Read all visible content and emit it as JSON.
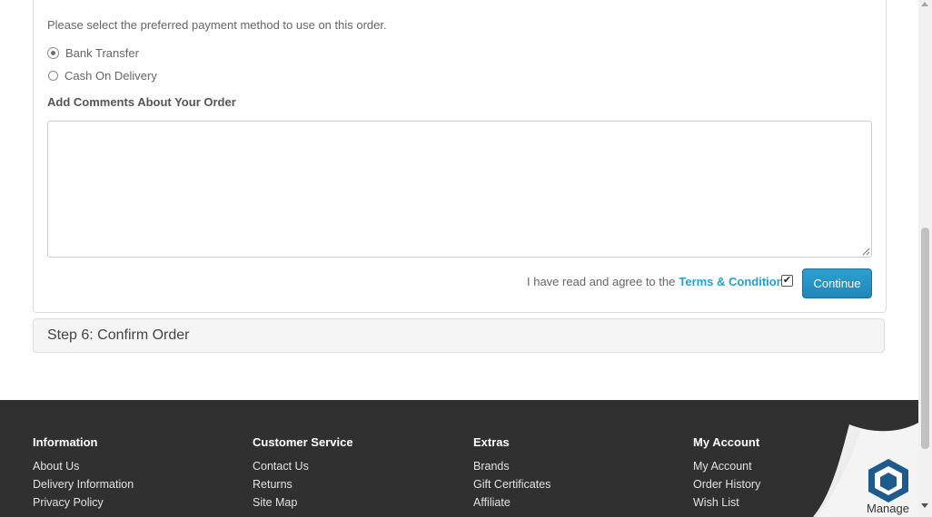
{
  "payment": {
    "instruction": "Please select the preferred payment method to use on this order.",
    "options": [
      {
        "label": "Bank Transfer",
        "selected": true
      },
      {
        "label": "Cash On Delivery",
        "selected": false
      }
    ],
    "comments_label": "Add Comments About Your Order",
    "comments_value": "",
    "agree_text": "I have read and agree to the",
    "terms_link": "Terms & Conditions",
    "agree_checked": true,
    "continue_label": "Continue"
  },
  "step6": {
    "title": "Step 6: Confirm Order"
  },
  "footer": {
    "columns": [
      {
        "heading": "Information",
        "links": [
          "About Us",
          "Delivery Information",
          "Privacy Policy"
        ]
      },
      {
        "heading": "Customer Service",
        "links": [
          "Contact Us",
          "Returns",
          "Site Map"
        ]
      },
      {
        "heading": "Extras",
        "links": [
          "Brands",
          "Gift Certificates",
          "Affiliate"
        ]
      },
      {
        "heading": "My Account",
        "links": [
          "My Account",
          "Order History",
          "Wish List"
        ]
      }
    ],
    "manage_label": "Manage"
  },
  "colors": {
    "link": "#23a1d1",
    "button": "#2392c5",
    "footer_bg": "#303030"
  },
  "icons": [
    "radio-selected-icon",
    "radio-empty-icon",
    "checkbox-checked-icon",
    "resize-grip-icon",
    "manage-cube-icon"
  ]
}
